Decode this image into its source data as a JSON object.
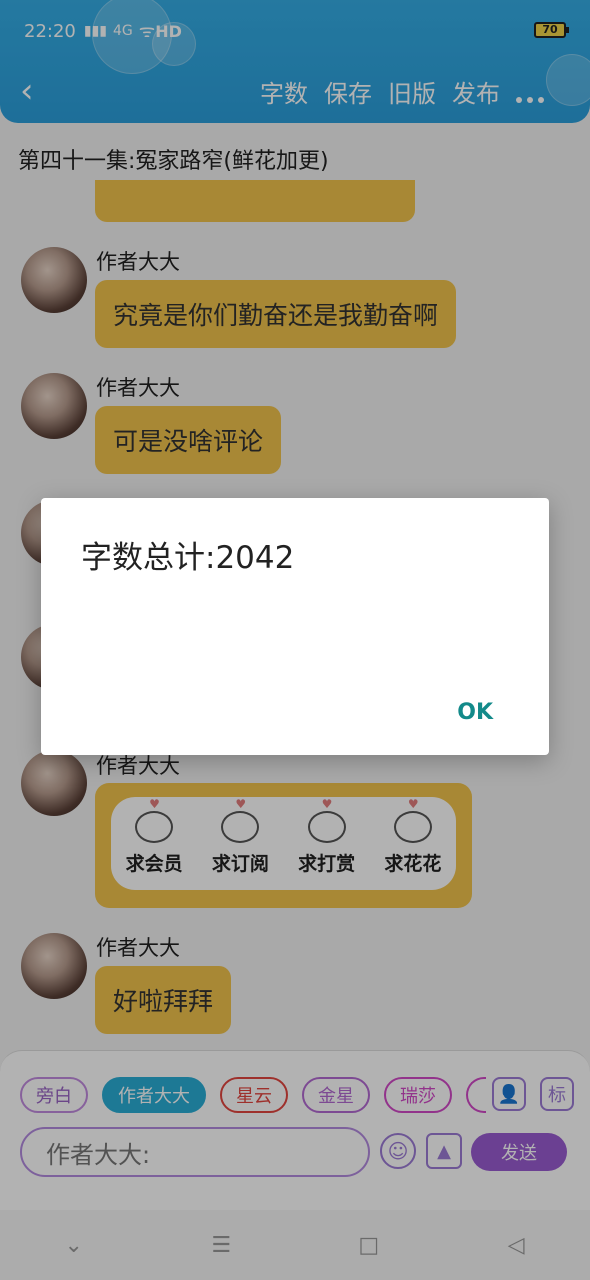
{
  "status": {
    "time": "22:20",
    "signal": "4G",
    "network": "HD",
    "battery": "70"
  },
  "header": {
    "back_icon": "back-arrow-icon",
    "menu": [
      "字数",
      "保存",
      "旧版",
      "发布"
    ],
    "more_icon": "more-dots-icon"
  },
  "chapter_title": "第四十一集:冤家路窄(鲜花加更)",
  "messages": [
    {
      "name": "作者大大",
      "text": "究竟是你们勤奋还是我勤奋啊"
    },
    {
      "name": "作者大大",
      "text": "可是没啥评论"
    },
    {
      "name": "作者大大",
      "stickers": [
        "求会员",
        "求订阅",
        "求打赏",
        "求花花"
      ]
    },
    {
      "name": "作者大大",
      "text": "好啦拜拜"
    }
  ],
  "dialog": {
    "title": "字数总计:2042",
    "ok": "OK"
  },
  "composer": {
    "chips": [
      "旁白",
      "作者大大",
      "星云",
      "金星",
      "瑞莎"
    ],
    "icon_person": "person-icon",
    "icon_mark": "标",
    "placeholder": "作者大大:",
    "emoji_icon": "emoji-icon",
    "image_icon": "image-icon",
    "send": "发送"
  },
  "nav": {
    "items": [
      "chevron-down-icon",
      "menu-icon",
      "home-square-icon",
      "back-triangle-icon"
    ]
  },
  "colors": {
    "header": "#2ba8e2",
    "bubble": "#f1c34d",
    "accent": "#9a5cd1",
    "ok": "#138a8a"
  }
}
